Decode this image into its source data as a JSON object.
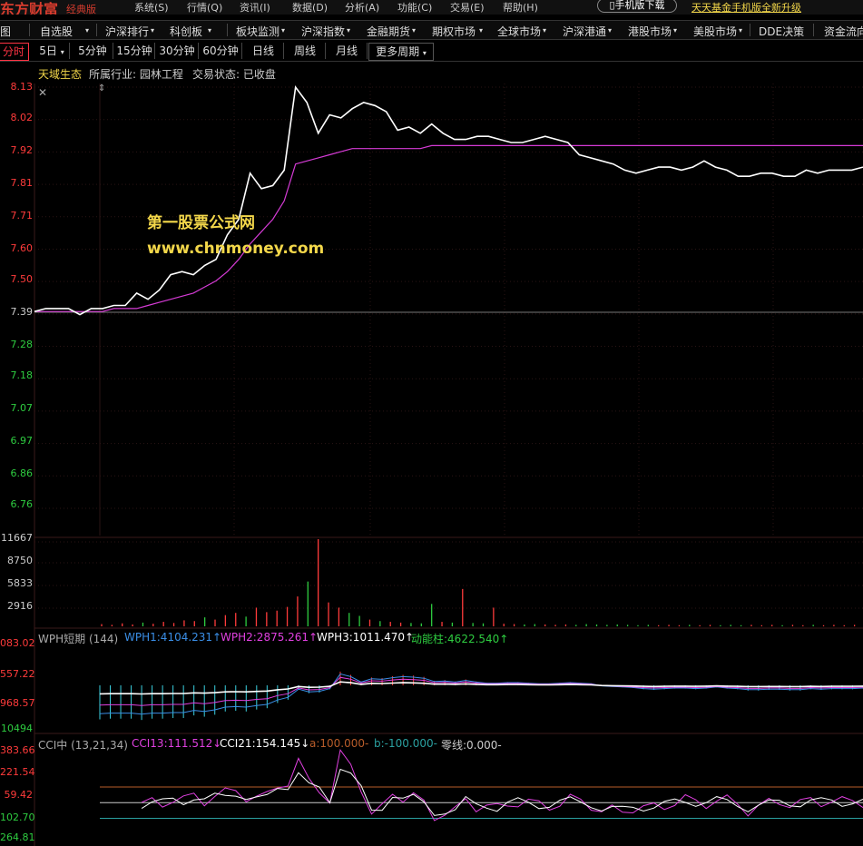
{
  "topbar": {
    "logo": "东方财富",
    "edition": "经典版",
    "menu": [
      "系统(S)",
      "行情(Q)",
      "资讯(I)",
      "数据(D)",
      "分析(A)",
      "功能(C)",
      "交易(E)",
      "帮助(H)"
    ],
    "mobile_download": "手机版下载",
    "promo": "天天基金手机版全新升级"
  },
  "menubar": {
    "items": [
      "图",
      "自选股",
      "沪深排行",
      "科创板",
      "板块监测",
      "沪深指数",
      "金融期货",
      "期权市场",
      "全球市场",
      "沪深港通",
      "港股市场",
      "美股市场",
      "DDE决策",
      "资金流向"
    ]
  },
  "periods": {
    "items": [
      "分时",
      "5日",
      "5分钟",
      "15分钟",
      "30分钟",
      "60分钟",
      "日线",
      "周线",
      "月线",
      "更多周期"
    ],
    "active": "分时"
  },
  "stock": {
    "name": "天域生态",
    "industry": "所属行业: 园林工程",
    "status": "交易状态: 已收盘"
  },
  "watermark": {
    "line1": "第一股票公式网",
    "line2": "www.chnmoney.com"
  },
  "colors": {
    "up": "#ff3b3b",
    "down": "#2ecc40",
    "price_line": "#ffffff",
    "avg_line": "#d63bd6",
    "wph1": "#3a8ee6",
    "wph2": "#e040e0",
    "cci_a": "#b85c2a",
    "cci_b": "#2aa0a0",
    "accent": "#f3d74a"
  },
  "price_axis": {
    "labels": [
      "8.13",
      "8.02",
      "7.92",
      "7.81",
      "7.71",
      "7.60",
      "7.50",
      "7.39",
      "7.28",
      "7.18",
      "7.07",
      "6.97",
      "6.86",
      "6.76"
    ],
    "prev_close": "7.39"
  },
  "volume_axis": {
    "labels": [
      "11667",
      "8750",
      "5833",
      "2916"
    ]
  },
  "wph": {
    "title": "WPH短期 (144)",
    "wph1": "WPH1:4104.231↑",
    "wph2": "WPH2:2875.261↑",
    "wph3": "WPH3:1011.470↑",
    "dong": "动能柱:4622.540↑",
    "axis": [
      "083.02",
      "557.22",
      "968.57",
      "10494"
    ]
  },
  "cci": {
    "title": "CCI中 (13,21,34)",
    "cci13": "CCI13:111.512↓",
    "cci21": "CCI21:154.145↓",
    "a": "a:100.000-",
    "b": "b:-100.000-",
    "zero": "零线:0.000-",
    "axis": [
      "383.66",
      "221.54",
      "59.42",
      "102.70",
      "264.81"
    ]
  },
  "chart_data": {
    "type": "line",
    "price_series": [
      {
        "name": "price",
        "values": [
          7.4,
          7.41,
          7.41,
          7.41,
          7.39,
          7.41,
          7.41,
          7.42,
          7.42,
          7.46,
          7.44,
          7.47,
          7.52,
          7.53,
          7.52,
          7.55,
          7.57,
          7.65,
          7.7,
          7.85,
          7.8,
          7.81,
          7.86,
          8.13,
          8.08,
          7.98,
          8.04,
          8.03,
          8.06,
          8.08,
          8.07,
          8.05,
          7.99,
          8.0,
          7.98,
          8.01,
          7.98,
          7.96,
          7.96,
          7.97,
          7.97,
          7.96,
          7.95,
          7.95,
          7.96,
          7.97,
          7.96,
          7.95,
          7.91,
          7.9,
          7.89,
          7.88,
          7.86,
          7.85,
          7.86,
          7.87,
          7.87,
          7.86,
          7.87,
          7.89,
          7.87,
          7.86,
          7.84,
          7.84,
          7.85,
          7.85,
          7.84,
          7.84,
          7.86,
          7.85,
          7.86,
          7.86,
          7.86,
          7.87
        ]
      },
      {
        "name": "avg",
        "values": [
          7.4,
          7.4,
          7.4,
          7.4,
          7.4,
          7.4,
          7.4,
          7.41,
          7.41,
          7.41,
          7.42,
          7.43,
          7.44,
          7.45,
          7.46,
          7.48,
          7.5,
          7.53,
          7.57,
          7.62,
          7.66,
          7.7,
          7.76,
          7.88,
          7.89,
          7.9,
          7.91,
          7.92,
          7.93,
          7.93,
          7.93,
          7.93,
          7.93,
          7.93,
          7.93,
          7.94,
          7.94,
          7.94,
          7.94,
          7.94,
          7.94,
          7.94,
          7.94,
          7.94,
          7.94,
          7.94,
          7.94,
          7.94,
          7.94,
          7.94,
          7.94,
          7.94,
          7.94,
          7.94,
          7.94,
          7.94,
          7.94,
          7.94,
          7.94,
          7.94,
          7.94,
          7.94,
          7.94,
          7.94,
          7.94,
          7.94,
          7.94,
          7.94,
          7.94,
          7.94,
          7.94,
          7.94,
          7.94,
          7.94
        ]
      }
    ],
    "price_ylim": [
      6.76,
      8.13
    ],
    "volume_values": [
      300,
      200,
      400,
      250,
      500,
      350,
      600,
      450,
      800,
      700,
      1200,
      900,
      1500,
      1800,
      1300,
      2500,
      1900,
      2100,
      2600,
      4000,
      6000,
      11667,
      3200,
      2500,
      1800,
      1400,
      900,
      700,
      600,
      500,
      450,
      400,
      3000,
      600,
      500,
      5000,
      450,
      400,
      2500,
      350,
      300,
      250,
      300,
      250,
      200,
      250,
      200,
      300,
      250,
      200,
      250,
      200,
      150,
      200,
      150,
      200,
      150,
      200,
      150,
      200,
      150,
      200,
      150,
      200,
      150,
      200,
      150,
      200,
      150,
      200,
      150,
      200,
      150,
      200
    ],
    "volume_ylim": [
      0,
      11667
    ],
    "cci_ylim": [
      -264.81,
      383.66
    ]
  }
}
